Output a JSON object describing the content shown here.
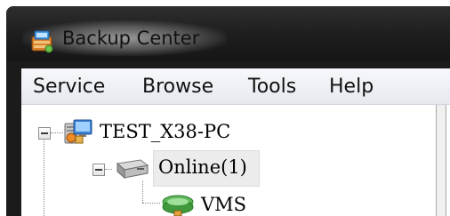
{
  "window": {
    "title": "Backup Center",
    "app_icon": "backup-center-icon"
  },
  "menu": {
    "items": [
      "Service",
      "Browse",
      "Tools",
      "Help"
    ]
  },
  "tree": {
    "root": {
      "label": "TEST_X38-PC",
      "icon": "computer-icon",
      "expanded": true
    },
    "group": {
      "label": "Online(1)",
      "icon": "drive-icon",
      "expanded": true
    },
    "child": {
      "label": "VMS",
      "icon": "network-device-icon"
    }
  },
  "colors": {
    "title_bar": "#1d1d1d",
    "menu_bar": "#eef0f5",
    "selection": "#ececec"
  }
}
